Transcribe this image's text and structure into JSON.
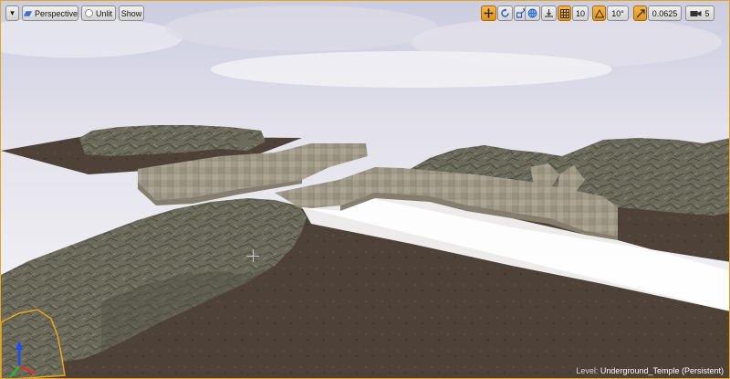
{
  "toolbar": {
    "menu_arrow": "▾",
    "perspective_label": "Perspective",
    "unlit_label": "Unlit",
    "show_label": "Show",
    "grid_snap_value": "10",
    "rotation_snap_value": "10°",
    "scale_snap_value": "0.0625",
    "camera_speed_value": "5"
  },
  "level": {
    "prefix": "Level:",
    "name": "Underground_Temple (Persistent)"
  },
  "colors": {
    "accent": "#e6a520",
    "sky": "#f1eff4",
    "ground": "#4c3f36",
    "rock": "#6b6a5c",
    "stone_floor": "#9e9888"
  }
}
